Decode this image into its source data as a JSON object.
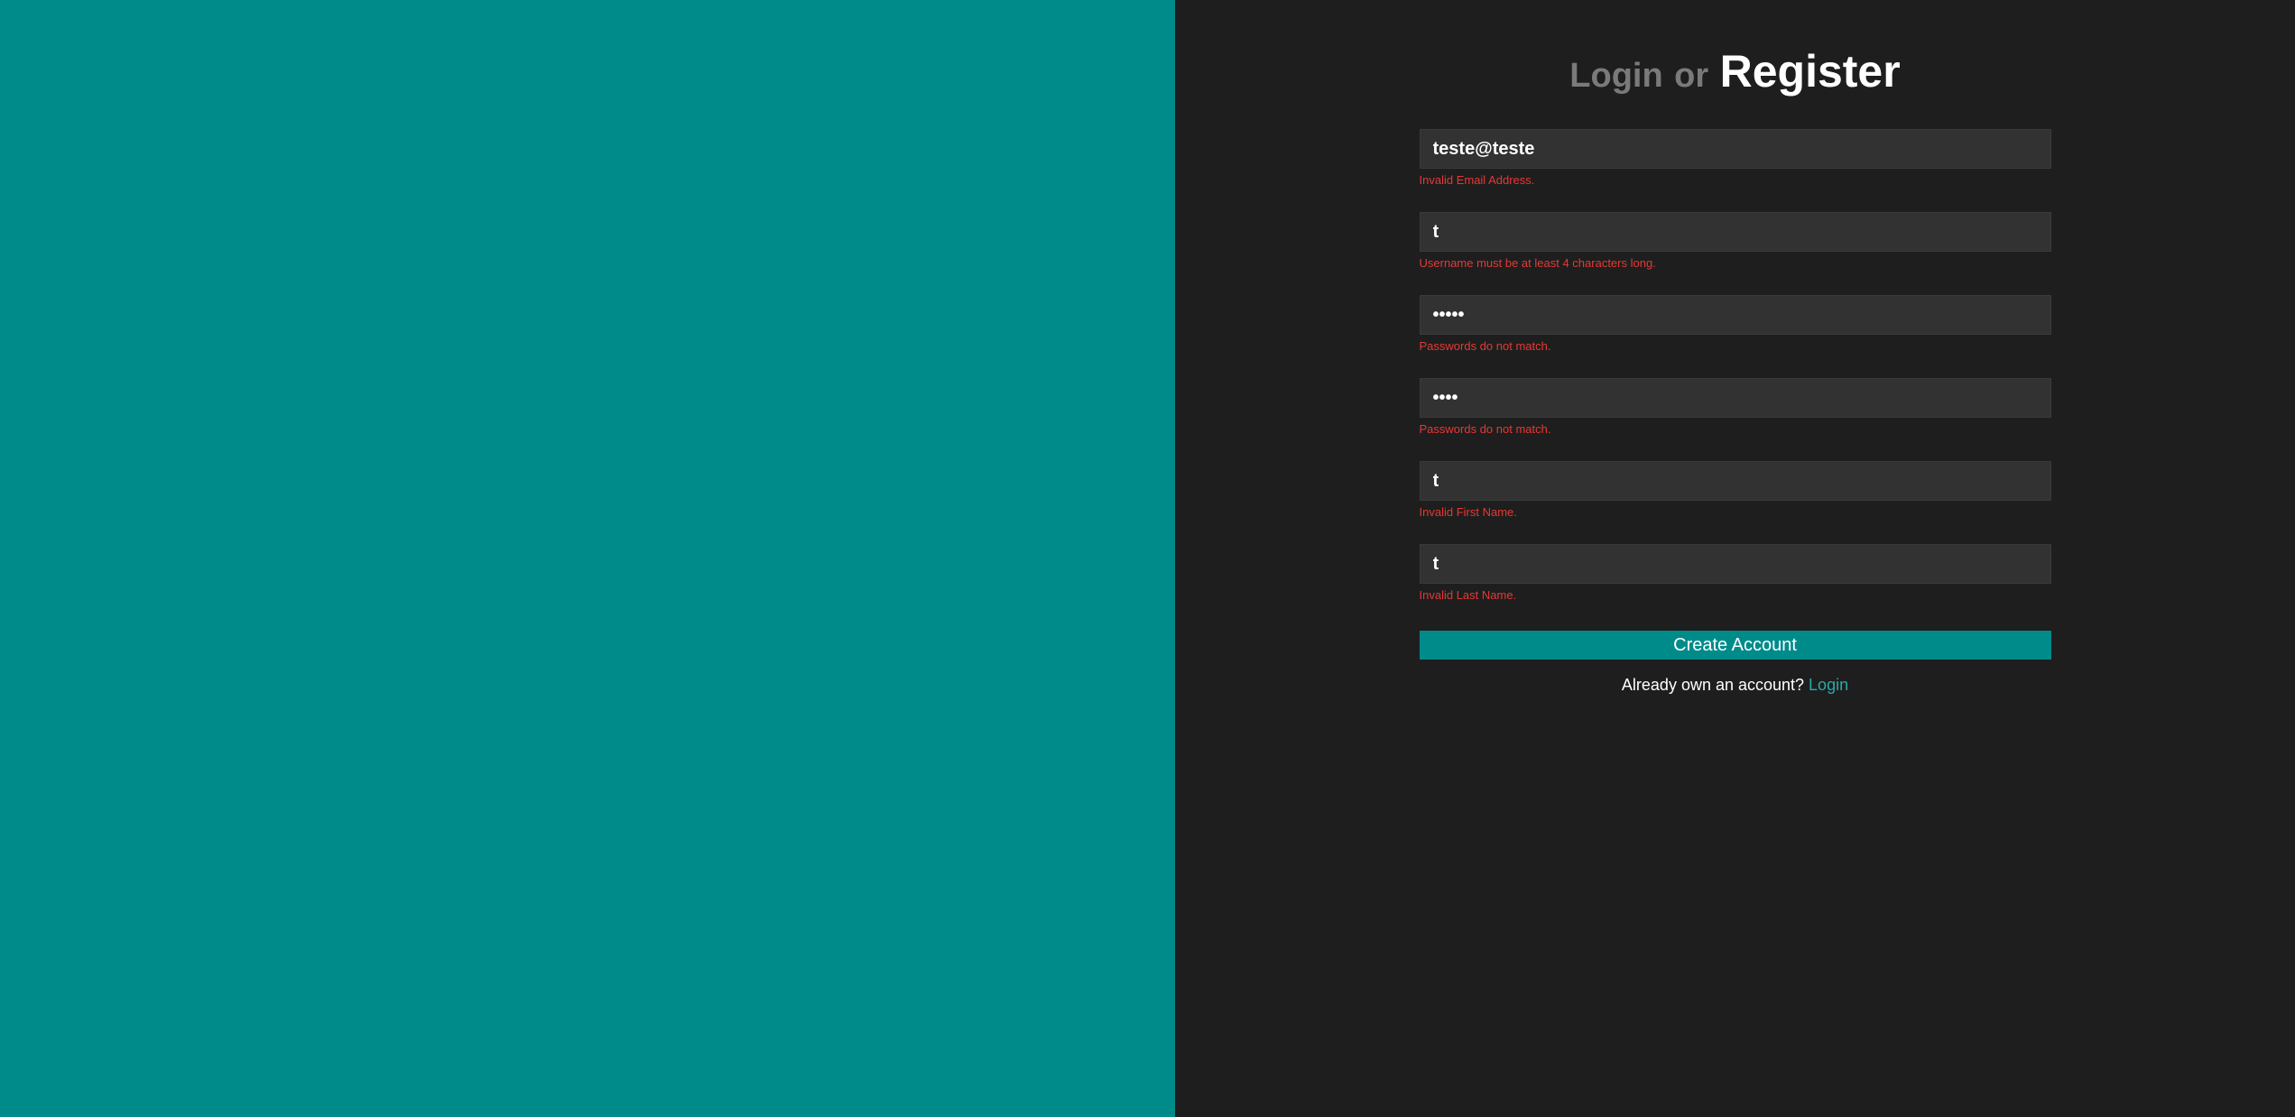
{
  "heading": {
    "login": "Login",
    "or": "or",
    "register": "Register"
  },
  "form": {
    "email": {
      "value": "teste@teste",
      "error": "Invalid Email Address."
    },
    "username": {
      "value": "t",
      "error": "Username must be at least 4 characters long."
    },
    "password": {
      "value": "•••••",
      "error": "Passwords do not match."
    },
    "confirm_password": {
      "value": "••••",
      "error": "Passwords do not match."
    },
    "first_name": {
      "value": "t",
      "error": "Invalid First Name."
    },
    "last_name": {
      "value": "t",
      "error": "Invalid Last Name."
    },
    "submit_label": "Create Account"
  },
  "footer": {
    "prompt": "Already own an account? ",
    "link_label": "Login"
  }
}
